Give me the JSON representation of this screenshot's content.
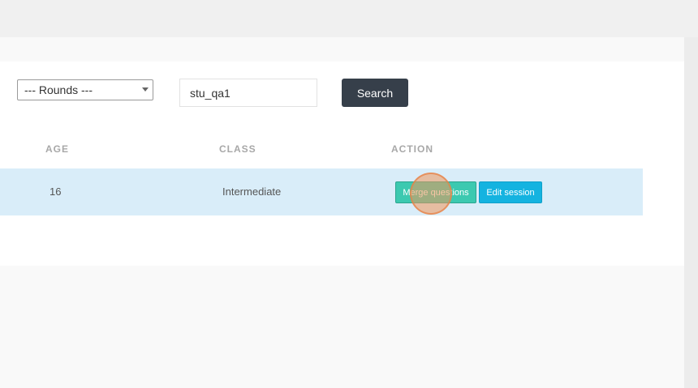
{
  "filters": {
    "rounds_select": "--- Rounds ---",
    "search_value": "stu_qa1",
    "search_button": "Search"
  },
  "table": {
    "headers": {
      "age": "AGE",
      "class": "CLASS",
      "action": "ACTION"
    },
    "rows": [
      {
        "age": "16",
        "class": "Intermediate",
        "actions": {
          "merge": "Merge questions",
          "edit": "Edit session"
        }
      }
    ]
  },
  "colors": {
    "row_highlight": "#d9edf9",
    "merge_button": "#3cc9b0",
    "edit_button": "#14b3e0",
    "search_button": "#363f4a"
  }
}
